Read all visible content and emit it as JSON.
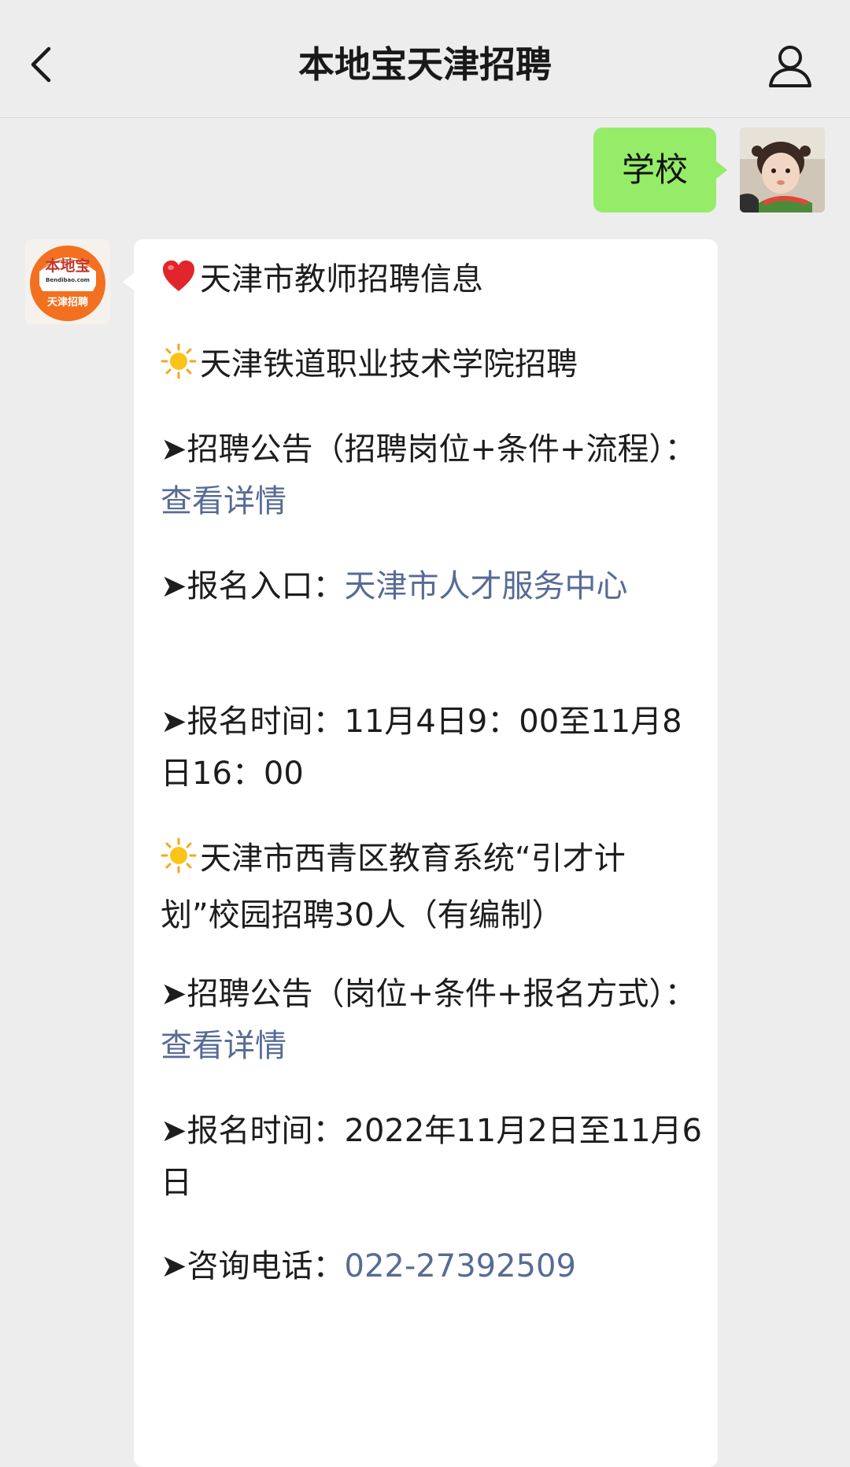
{
  "header": {
    "title": "本地宝天津招聘"
  },
  "chat": {
    "user_message": "学校",
    "bot_avatar": {
      "logo_text_top": "本地宝",
      "logo_text_mid": "Bendibao.com",
      "logo_text_bottom": "天津招聘"
    },
    "message": {
      "line1_text": "天津市教师招聘信息",
      "line2_text": "天津铁道职业技术学院招聘",
      "line3_prefix": "➤招聘公告（招聘岗位+条件+流程）：",
      "line3_link": "查看详情",
      "line4_prefix": "➤报名入口：",
      "line4_link": "天津市人才服务中心",
      "line5_text": "➤报名时间：11月4日9：00至11月8日16：00",
      "line6_text": "天津市西青区教育系统“引才计划”校园招聘30人（有编制）",
      "line7_prefix": "➤招聘公告（岗位+条件+报名方式）：",
      "line7_link": "查看详情",
      "line8_text": "➤报名时间：2022年11月2日至11月6日",
      "line9_prefix": "➤咨询电话：",
      "line9_link": "022-27392509"
    }
  },
  "colors": {
    "user_bubble": "#95ec69",
    "link": "#576b95",
    "logo_orange": "#f37021"
  },
  "icons": {
    "back": "chevron-left-icon",
    "profile": "person-icon",
    "heart": "heart-icon",
    "sun": "sun-icon"
  }
}
